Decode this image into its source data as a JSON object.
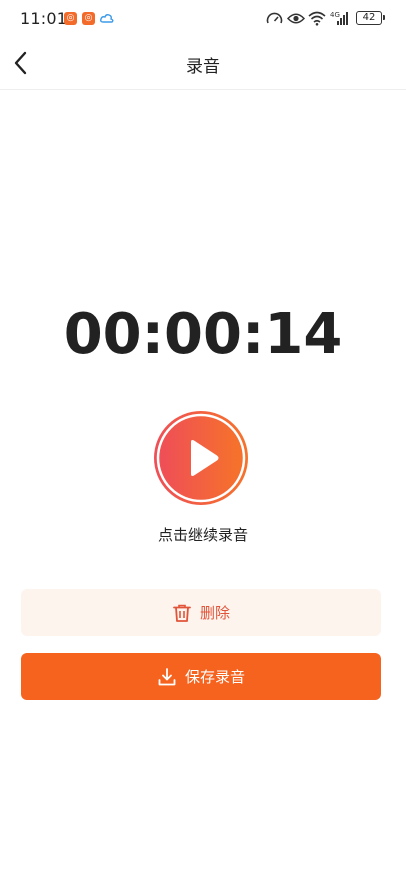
{
  "status_bar": {
    "time": "11:01",
    "battery": "42",
    "network": "4G"
  },
  "nav": {
    "title": "录音"
  },
  "recorder": {
    "elapsed": "00:00:14",
    "hint": "点击继续录音"
  },
  "actions": {
    "delete_label": "删除",
    "save_label": "保存录音"
  },
  "colors": {
    "accent": "#f6631f",
    "delete_bg": "#fef4ee",
    "delete_text": "#e1543a",
    "play_gradient_start": "#ef4e57",
    "play_gradient_end": "#f6732a"
  },
  "icons": {
    "back": "chevron-left-icon",
    "play": "play-icon",
    "delete": "trash-icon",
    "save": "download-icon"
  }
}
